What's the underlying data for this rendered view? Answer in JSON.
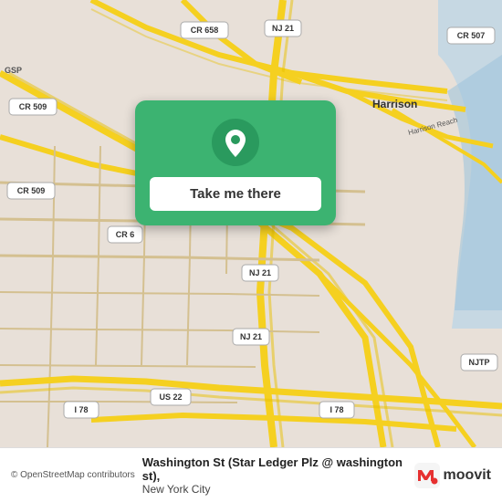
{
  "map": {
    "background_color": "#e8e0d8"
  },
  "card": {
    "button_label": "Take me there",
    "background_color": "#3cb371"
  },
  "bottom_bar": {
    "osm_credit": "© OpenStreetMap contributors",
    "location_name": "Washington St (Star Ledger Plz @ washington st),",
    "location_city": "New York City",
    "moovit_label": "moovit"
  }
}
